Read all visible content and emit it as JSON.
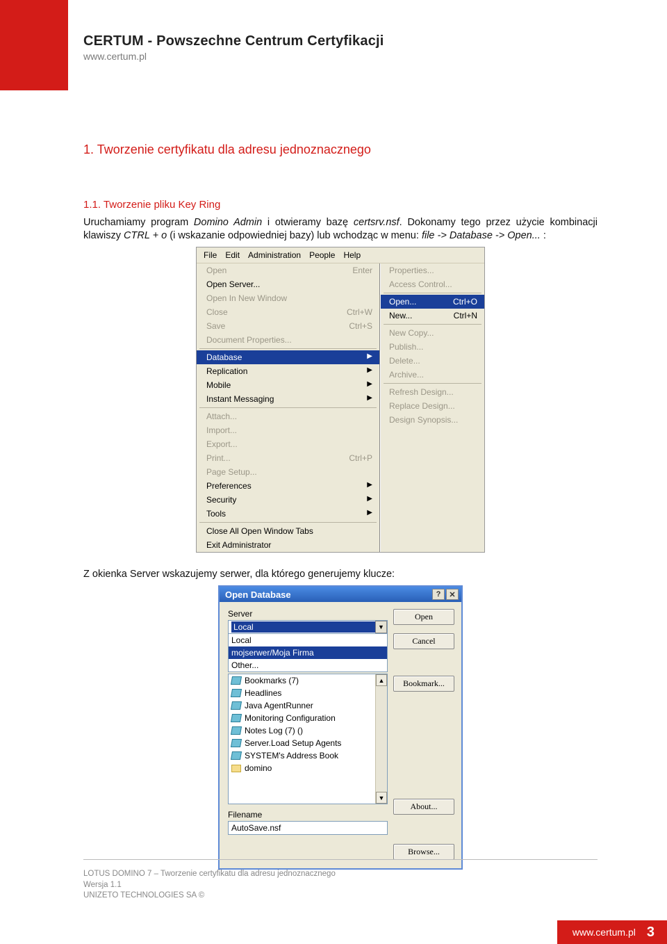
{
  "header": {
    "title": "CERTUM - Powszechne Centrum Certyfikacji",
    "url": "www.certum.pl"
  },
  "section1_heading": "1.  Tworzenie certyfikatu dla adresu jednoznacznego",
  "section11_heading": "1.1.  Tworzenie pliku Key Ring",
  "para1_pre": "Uruchamiamy program ",
  "para1_em1": "Domino Admin",
  "para1_mid": " i otwieramy bazę ",
  "para1_em2": "certsrv.nsf",
  "para1_post": ". Dokonamy tego przez użycie kombinacji klawiszy ",
  "para1_em3": "CTRL + o",
  "para1_mid2": " (i wskazanie odpowiedniej bazy) lub wchodząc w menu: ",
  "para1_em4": "file -> Database -> Open...",
  "para1_end": " :",
  "para2": "Z okienka Server wskazujemy serwer, dla którego generujemy klucze:",
  "menubar": [
    "File",
    "Edit",
    "Administration",
    "People",
    "Help"
  ],
  "file_menu": [
    {
      "label": "Open",
      "shortcut": "Enter",
      "disabled": true
    },
    {
      "label": "Open Server...",
      "shortcut": "",
      "disabled": false
    },
    {
      "label": "Open In New Window",
      "shortcut": "",
      "disabled": true
    },
    {
      "label": "Close",
      "shortcut": "Ctrl+W",
      "disabled": true
    },
    {
      "label": "Save",
      "shortcut": "Ctrl+S",
      "disabled": true
    },
    {
      "label": "Document Properties...",
      "shortcut": "",
      "disabled": true
    },
    {
      "sep": true
    },
    {
      "label": "Database",
      "arrow": true,
      "selected": true
    },
    {
      "label": "Replication",
      "arrow": true
    },
    {
      "label": "Mobile",
      "arrow": true
    },
    {
      "label": "Instant Messaging",
      "arrow": true
    },
    {
      "sep": true
    },
    {
      "label": "Attach...",
      "disabled": true
    },
    {
      "label": "Import...",
      "disabled": true
    },
    {
      "label": "Export...",
      "disabled": true
    },
    {
      "label": "Print...",
      "shortcut": "Ctrl+P",
      "disabled": true
    },
    {
      "label": "Page Setup...",
      "disabled": true
    },
    {
      "label": "Preferences",
      "arrow": true
    },
    {
      "label": "Security",
      "arrow": true
    },
    {
      "label": "Tools",
      "arrow": true
    },
    {
      "sep": true
    },
    {
      "label": "Close All Open Window Tabs"
    },
    {
      "label": "Exit Administrator"
    }
  ],
  "db_submenu": [
    {
      "label": "Properties...",
      "disabled": true
    },
    {
      "label": "Access Control...",
      "disabled": true
    },
    {
      "sep": true
    },
    {
      "label": "Open...",
      "shortcut": "Ctrl+O",
      "selected": true,
      "enabled": true
    },
    {
      "label": "New...",
      "shortcut": "Ctrl+N",
      "enabled": true
    },
    {
      "sep": true
    },
    {
      "label": "New Copy...",
      "disabled": true
    },
    {
      "label": "Publish...",
      "disabled": true
    },
    {
      "label": "Delete...",
      "disabled": true
    },
    {
      "label": "Archive...",
      "disabled": true
    },
    {
      "sep": true
    },
    {
      "label": "Refresh Design...",
      "disabled": true
    },
    {
      "label": "Replace Design...",
      "disabled": true
    },
    {
      "label": "Design Synopsis...",
      "disabled": true
    }
  ],
  "dialog": {
    "title": "Open Database",
    "server_label": "Server",
    "server_value": "Local",
    "server_options": [
      "Local",
      "mojserwer/Moja Firma",
      "Other..."
    ],
    "db_items": [
      {
        "label": "Bookmarks (7)",
        "type": "db"
      },
      {
        "label": "Headlines",
        "type": "db"
      },
      {
        "label": "Java AgentRunner",
        "type": "db"
      },
      {
        "label": "Monitoring Configuration",
        "type": "db"
      },
      {
        "label": "Notes Log (7) ()",
        "type": "db"
      },
      {
        "label": "Server.Load Setup Agents",
        "type": "db"
      },
      {
        "label": "SYSTEM's Address Book",
        "type": "db"
      },
      {
        "label": "domino",
        "type": "folder"
      }
    ],
    "filename_label": "Filename",
    "filename_value": "AutoSave.nsf",
    "btn_open": "Open",
    "btn_cancel": "Cancel",
    "btn_bookmark": "Bookmark...",
    "btn_about": "About...",
    "btn_browse": "Browse..."
  },
  "footer": {
    "line1": "LOTUS DOMINO 7 – Tworzenie certyfikatu dla adresu jednoznacznego",
    "line2": "Wersja 1.1",
    "line3": "UNIZETO TECHNOLOGIES SA ©",
    "url": "www.certum.pl",
    "page": "3"
  }
}
